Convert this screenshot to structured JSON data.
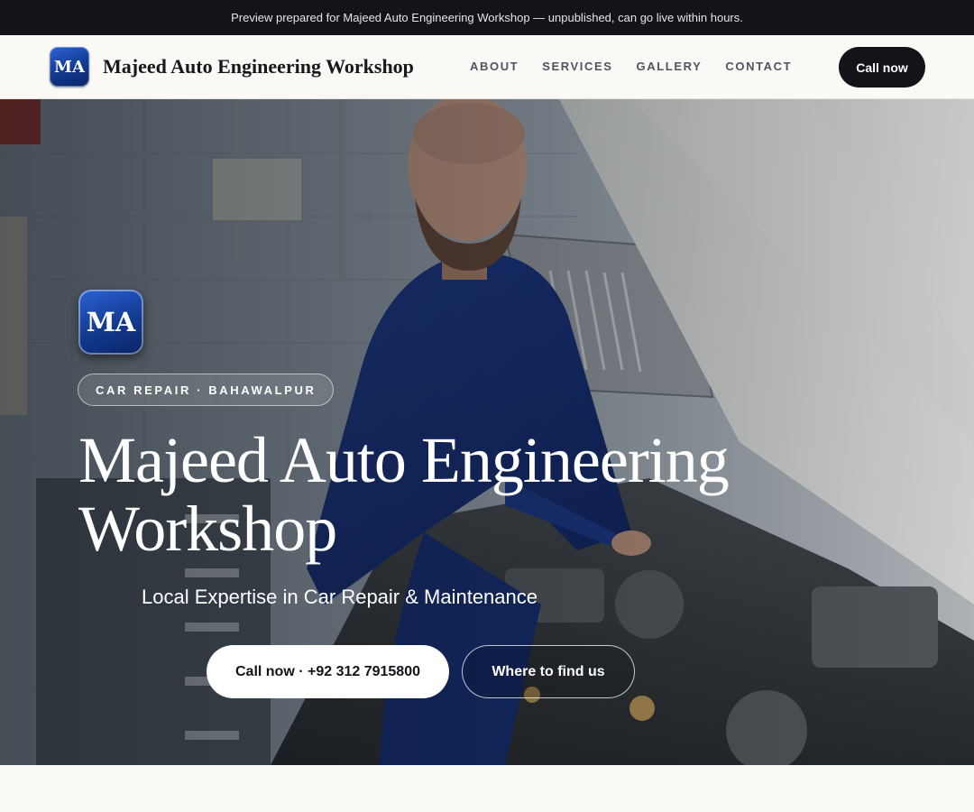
{
  "preview_bar": {
    "text": "Preview prepared for Majeed Auto Engineering Workshop — unpublished, can go live within hours."
  },
  "header": {
    "logo_text": "MA",
    "brand_name": "Majeed Auto Engineering Workshop",
    "nav": [
      {
        "label": "ABOUT"
      },
      {
        "label": "SERVICES"
      },
      {
        "label": "GALLERY"
      },
      {
        "label": "CONTACT"
      }
    ],
    "cta_label": "Call now"
  },
  "hero": {
    "logo_text": "MA",
    "chip": "CAR REPAIR · BAHAWALPUR",
    "title": "Majeed Auto Engineering Workshop",
    "tagline": "Local Expertise in Car Repair & Maintenance",
    "call_button": "Call now · +92 312 7915800",
    "find_button": "Where to find us"
  },
  "colors": {
    "dark": "#12141a",
    "brand_blue": "#123a8f",
    "page_bg": "#faf9f6"
  }
}
